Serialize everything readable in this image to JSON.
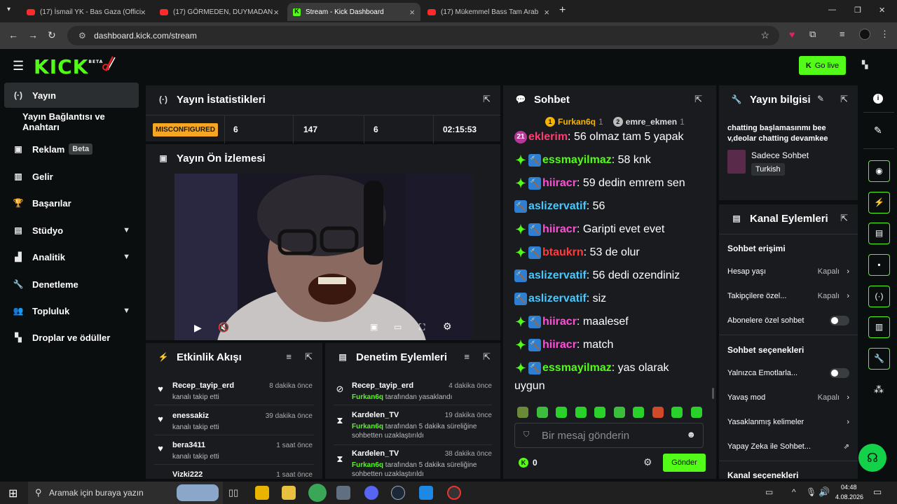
{
  "browser": {
    "tabs": [
      {
        "title": "(17) İsmail YK - Bas Gaza (Offici",
        "type": "youtube"
      },
      {
        "title": "(17) GÖRMEDEN, DUYMADAN",
        "type": "youtube"
      },
      {
        "title": "Stream - Kick Dashboard",
        "type": "kick",
        "active": true
      },
      {
        "title": "(17) Mükemmel Bass Tam Arab",
        "type": "youtube"
      }
    ],
    "new_tab": "+",
    "url": "dashboard.kick.com/stream",
    "window_controls": [
      "—",
      "❐",
      "✕"
    ]
  },
  "kick": {
    "logo": "KICK",
    "logo_sup": "BETA",
    "go_live": "Go live"
  },
  "sidebar": {
    "items": [
      {
        "label": "Yayın",
        "icon": "broadcast-icon",
        "glyph": "(·)",
        "active": true
      },
      {
        "label": "Yayın Bağlantısı ve Anahtarı",
        "icon": "",
        "glyph": ""
      },
      {
        "label": "Reklam",
        "icon": "ad-icon",
        "glyph": "▣",
        "badge": "Beta"
      },
      {
        "label": "Gelir",
        "icon": "revenue-icon",
        "glyph": "▥"
      },
      {
        "label": "Başarılar",
        "icon": "trophy-icon",
        "glyph": "🏆"
      },
      {
        "label": "Stüdyo",
        "icon": "studio-icon",
        "glyph": "▤",
        "chevron": true
      },
      {
        "label": "Analitik",
        "icon": "analytics-icon",
        "glyph": "▟",
        "chevron": true
      },
      {
        "label": "Denetleme",
        "icon": "wrench-icon",
        "glyph": "🔧"
      },
      {
        "label": "Topluluk",
        "icon": "community-icon",
        "glyph": "👥",
        "chevron": true
      },
      {
        "label": "Droplar ve ödüller",
        "icon": "drops-icon",
        "glyph": "▚"
      }
    ]
  },
  "stats": {
    "title": "Yayın İstatistikleri",
    "status": "MISCONFIGURED",
    "values": [
      "6",
      "147",
      "6",
      "02:15:53"
    ]
  },
  "preview": {
    "title": "Yayın Ön İzlemesi"
  },
  "activity": {
    "title": "Etkinlik Akışı",
    "items": [
      {
        "name": "Recep_tayip_erd",
        "time": "8 dakika önce",
        "sub": "kanalı takip etti"
      },
      {
        "name": "enessakiz",
        "time": "39 dakika önce",
        "sub": "kanalı takip etti"
      },
      {
        "name": "bera3411",
        "time": "1 saat önce",
        "sub": "kanalı takip etti"
      },
      {
        "name": "Vizki222",
        "time": "1 saat önce",
        "sub": ""
      }
    ]
  },
  "moderation": {
    "title": "Denetim Eylemleri",
    "items": [
      {
        "name": "Recep_tayip_erd",
        "time": "4 dakika önce",
        "actor": "Furkan6q",
        "sub": "tarafından yasaklandı",
        "sub2": "",
        "icon": "ban-icon"
      },
      {
        "name": "Kardelen_TV",
        "time": "19 dakika önce",
        "actor": "Furkan6q",
        "sub": "tarafından 5 dakika süreliğine",
        "sub2": "sohbetten uzaklaştırıldı",
        "icon": "hourglass-icon"
      },
      {
        "name": "Kardelen_TV",
        "time": "38 dakika önce",
        "actor": "Furkan6q",
        "sub": "tarafından 5 dakika süreliğine",
        "sub2": "sohbetten uzaklaştırıldı",
        "icon": "hourglass-icon"
      }
    ]
  },
  "chat": {
    "title": "Sohbet",
    "pinned": [
      {
        "rank": "1",
        "name": "Furkan6q",
        "count": "1"
      },
      {
        "rank": "2",
        "name": "emre_ekmen",
        "count": "1"
      }
    ],
    "messages": [
      {
        "badges": [
          "21"
        ],
        "user": "eklerim",
        "color": "#ff3b73",
        "text": ": 56 olmaz tam 5 yapak"
      },
      {
        "badges": [
          "green",
          "blue"
        ],
        "user": "essmayilmaz",
        "color": "#53fc18",
        "text": ": 58 knk"
      },
      {
        "badges": [
          "green",
          "blue"
        ],
        "user": "hiiracr",
        "color": "#ff4fd8",
        "text": ": 59 dedin emrem sen"
      },
      {
        "badges": [
          "blue"
        ],
        "user": "aslizervatif",
        "color": "#45c9ff",
        "text": ": 56"
      },
      {
        "badges": [
          "green",
          "blue"
        ],
        "user": "hiiracr",
        "color": "#ff4fd8",
        "text": ": Garipti evet evet"
      },
      {
        "badges": [
          "green",
          "blue"
        ],
        "user": "btaukrn",
        "color": "#ff3b3b",
        "text": ": 53 de olur"
      },
      {
        "badges": [
          "blue"
        ],
        "user": "aslizervatif",
        "color": "#45c9ff",
        "text": ": 56 dedi ozendiniz"
      },
      {
        "badges": [
          "blue"
        ],
        "user": "aslizervatif",
        "color": "#45c9ff",
        "text": ": siz"
      },
      {
        "badges": [
          "green",
          "blue"
        ],
        "user": "hiiracr",
        "color": "#ff4fd8",
        "text": ": maalesef"
      },
      {
        "badges": [
          "green",
          "blue"
        ],
        "user": "hiiracr",
        "color": "#ff4fd8",
        "text": ": match"
      },
      {
        "badges": [
          "green",
          "blue"
        ],
        "user": "essmayilmaz",
        "color": "#53fc18",
        "text": ": yas olarak"
      }
    ],
    "wrap_line": "uygun",
    "input_placeholder": "Bir mesaj gönderin",
    "points": "0",
    "send": "Gönder"
  },
  "stream_info": {
    "title": "Yayın bilgisi",
    "description": "chatting başlamasınmı bee v,deolar chatting devamkee",
    "category": "Sadece Sohbet",
    "language": "Turkish"
  },
  "channel_actions": {
    "title": "Kanal Eylemleri",
    "section1": "Sohbet erişimi",
    "account_age": "Hesap yaşı",
    "account_age_val": "Kapalı",
    "followers_only": "Takipçilere özel...",
    "followers_only_val": "Kapalı",
    "subs_only": "Abonelere özel sohbet",
    "section2": "Sohbet seçenekleri",
    "emotes_only": "Yalnızca Emotlarla...",
    "slow_mode": "Yavaş mod",
    "slow_mode_val": "Kapalı",
    "banned_words": "Yasaklanmış kelimeler",
    "ai_chat": "Yapay Zeka ile Sohbet...",
    "section3": "Kanal seçenekleri"
  },
  "taskbar": {
    "search_placeholder": "Aramak için buraya yazın",
    "time": "04:48",
    "date": "4.08.2026"
  },
  "colors": {
    "kick_green": "#53fc18",
    "panel_bg": "#191b1f",
    "page_bg": "#0b0e0f",
    "misconfigured": "#f5a623"
  }
}
